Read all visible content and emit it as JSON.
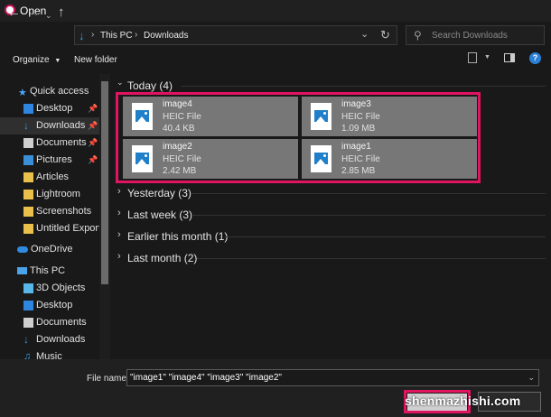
{
  "window": {
    "title": "Open"
  },
  "nav": {
    "breadcrumb": [
      "This PC",
      "Downloads"
    ],
    "search_placeholder": "Search Downloads"
  },
  "toolbar": {
    "organize_label": "Organize",
    "new_folder_label": "New folder"
  },
  "sidebar": {
    "quick_access": "Quick access",
    "quick_items": [
      {
        "label": "Desktop",
        "icon": "desktop-folder-icon",
        "pinned": true
      },
      {
        "label": "Downloads",
        "icon": "downloads-folder-icon",
        "pinned": true
      },
      {
        "label": "Documents",
        "icon": "documents-folder-icon",
        "pinned": true
      },
      {
        "label": "Pictures",
        "icon": "pictures-folder-icon",
        "pinned": true
      },
      {
        "label": "Articles",
        "icon": "folder-icon",
        "pinned": false
      },
      {
        "label": "Lightroom",
        "icon": "folder-icon",
        "pinned": false
      },
      {
        "label": "Screenshots",
        "icon": "folder-icon",
        "pinned": false
      },
      {
        "label": "Untitled Export",
        "icon": "folder-icon",
        "pinned": false
      }
    ],
    "onedrive": "OneDrive",
    "this_pc": "This PC",
    "pc_items": [
      {
        "label": "3D Objects",
        "icon": "3d-objects-icon"
      },
      {
        "label": "Desktop",
        "icon": "desktop-folder-icon"
      },
      {
        "label": "Documents",
        "icon": "documents-folder-icon"
      },
      {
        "label": "Downloads",
        "icon": "downloads-folder-icon"
      },
      {
        "label": "Music",
        "icon": "music-folder-icon"
      }
    ]
  },
  "content": {
    "groups": [
      {
        "label": "Today (4)",
        "expanded": true
      },
      {
        "label": "Yesterday (3)",
        "expanded": false
      },
      {
        "label": "Last week (3)",
        "expanded": false
      },
      {
        "label": "Earlier this month (1)",
        "expanded": false
      },
      {
        "label": "Last month (2)",
        "expanded": false
      }
    ],
    "files": [
      {
        "name": "image4",
        "type": "HEIC File",
        "size": "40.4 KB"
      },
      {
        "name": "image3",
        "type": "HEIC File",
        "size": "1.09 MB"
      },
      {
        "name": "image2",
        "type": "HEIC File",
        "size": "2.42 MB"
      },
      {
        "name": "image1",
        "type": "HEIC File",
        "size": "2.85 MB"
      }
    ]
  },
  "bottom": {
    "filename_label": "File name:",
    "filename_value": "\"image1\" \"image4\" \"image3\" \"image2\"",
    "watermark": "shenmazhishi.com"
  },
  "colors": {
    "highlight": "#e01460",
    "accent": "#1f7fc8",
    "selected_tile": "#777777"
  }
}
